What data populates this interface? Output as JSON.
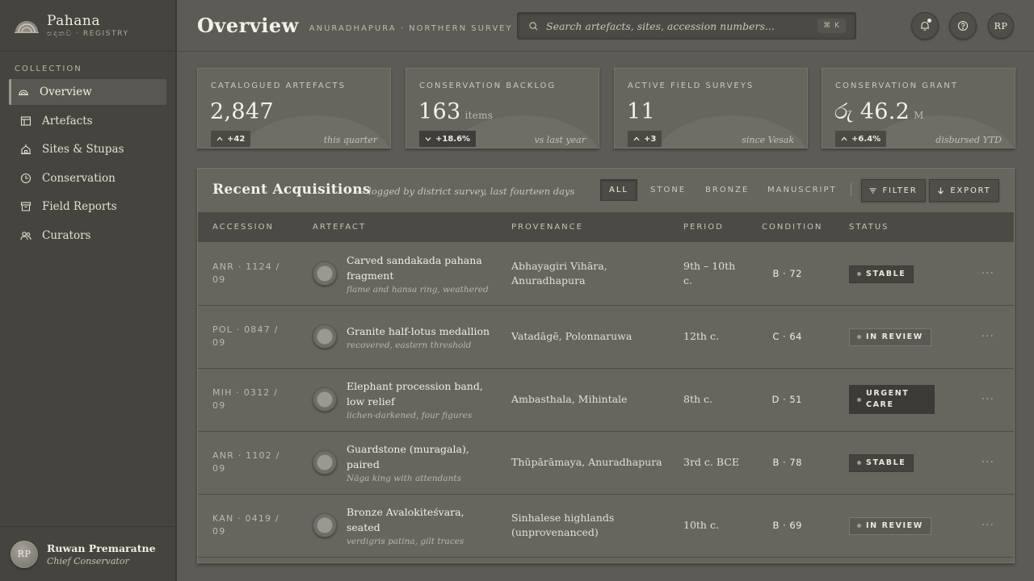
{
  "brand": {
    "name": "Pahana",
    "subtitle": "සඳකඩ · REGISTRY"
  },
  "sidebar": {
    "heading": "COLLECTION",
    "items": [
      {
        "label": "Overview",
        "icon": "stupa-icon",
        "active": true
      },
      {
        "label": "Artefacts",
        "icon": "catalogue-icon"
      },
      {
        "label": "Sites & Stupas",
        "icon": "temple-icon"
      },
      {
        "label": "Conservation",
        "icon": "clock-icon"
      },
      {
        "label": "Field Reports",
        "icon": "archive-icon"
      },
      {
        "label": "Curators",
        "icon": "people-icon"
      }
    ]
  },
  "user": {
    "initials": "RP",
    "name": "Ruwan Premaratne",
    "role": "Chief Conservator"
  },
  "header": {
    "title": "Overview",
    "subtitle": "ANURADHAPURA · NORTHERN SURVEY",
    "search_placeholder": "Search artefacts, sites, accession numbers...",
    "shortcut": "⌘ K",
    "avatar": "RP"
  },
  "kpis": [
    {
      "label": "CATALOGUED ARTEFACTS",
      "value": "2,847",
      "unit": "",
      "delta": "+42",
      "direction": "up",
      "note": "this quarter"
    },
    {
      "label": "CONSERVATION BACKLOG",
      "value": "163",
      "unit": "items",
      "delta": "+18.6%",
      "direction": "down",
      "note": "vs last year"
    },
    {
      "label": "ACTIVE FIELD SURVEYS",
      "value": "11",
      "unit": "",
      "delta": "+3",
      "direction": "up",
      "note": "since Vesak"
    },
    {
      "label": "CONSERVATION GRANT",
      "value": "රු 46.2",
      "unit": "M",
      "delta": "+6.4%",
      "direction": "up",
      "note": "disbursed YTD"
    }
  ],
  "table": {
    "title": "Recent Acquisitions",
    "subtitle": "— logged by district survey, last fourteen days",
    "filters": [
      "ALL",
      "STONE",
      "BRONZE",
      "MANUSCRIPT"
    ],
    "active_filter": "ALL",
    "filter_button": "FILTER",
    "export_button": "EXPORT",
    "columns": [
      "ACCESSION",
      "ARTEFACT",
      "PROVENANCE",
      "PERIOD",
      "CONDITION",
      "STATUS"
    ],
    "rows": [
      {
        "accession": "ANR · 1124 / 09",
        "name": "Carved sandakada pahana fragment",
        "desc": "flame and hansa ring, weathered",
        "provenance": "Abhayagiri Vihāra, Anuradhapura",
        "period": "9th – 10th c.",
        "condition": "B · 72",
        "status": "STABLE",
        "status_kind": "stable"
      },
      {
        "accession": "POL · 0847 / 09",
        "name": "Granite half-lotus medallion",
        "desc": "recovered, eastern threshold",
        "provenance": "Vatadāgē, Polonnaruwa",
        "period": "12th c.",
        "condition": "C · 64",
        "status": "IN REVIEW",
        "status_kind": "review"
      },
      {
        "accession": "MIH · 0312 / 09",
        "name": "Elephant procession band, low relief",
        "desc": "lichen-darkened, four figures",
        "provenance": "Ambasthala, Mihintale",
        "period": "8th c.",
        "condition": "D · 51",
        "status": "URGENT CARE",
        "status_kind": "urgent"
      },
      {
        "accession": "ANR · 1102 / 09",
        "name": "Guardstone (muragala), paired",
        "desc": "Nāga king with attendants",
        "provenance": "Thūpārāmaya, Anuradhapura",
        "period": "3rd c. BCE",
        "condition": "B · 78",
        "status": "STABLE",
        "status_kind": "stable"
      },
      {
        "accession": "KAN · 0419 / 09",
        "name": "Bronze Avalokiteśvara, seated",
        "desc": "verdigris patina, gilt traces",
        "provenance": "Sinhalese highlands (unprovenanced)",
        "period": "10th c.",
        "condition": "B · 69",
        "status": "IN REVIEW",
        "status_kind": "review"
      }
    ],
    "more": "···"
  }
}
